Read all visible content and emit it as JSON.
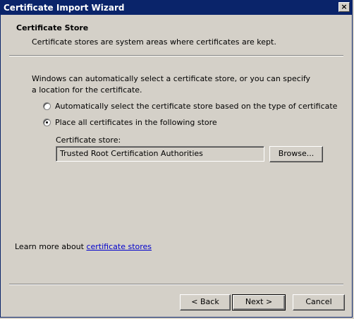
{
  "window": {
    "title": "Certificate Import Wizard",
    "close_glyph": "×"
  },
  "header": {
    "title": "Certificate Store",
    "subtitle": "Certificate stores are system areas where certificates are kept."
  },
  "body": {
    "description": "Windows can automatically select a certificate store, or you can specify a location for the certificate.",
    "options": [
      {
        "label": "Automatically select the certificate store based on the type of certificate",
        "checked": false
      },
      {
        "label": "Place all certificates in the following store",
        "checked": true
      }
    ],
    "store_label": "Certificate store:",
    "store_value": "Trusted Root Certification Authorities",
    "browse_label": "Browse..."
  },
  "footer": {
    "learn_prefix": "Learn more about ",
    "learn_link": "certificate stores",
    "back_label": "< Back",
    "next_label": "Next >",
    "cancel_label": "Cancel"
  }
}
